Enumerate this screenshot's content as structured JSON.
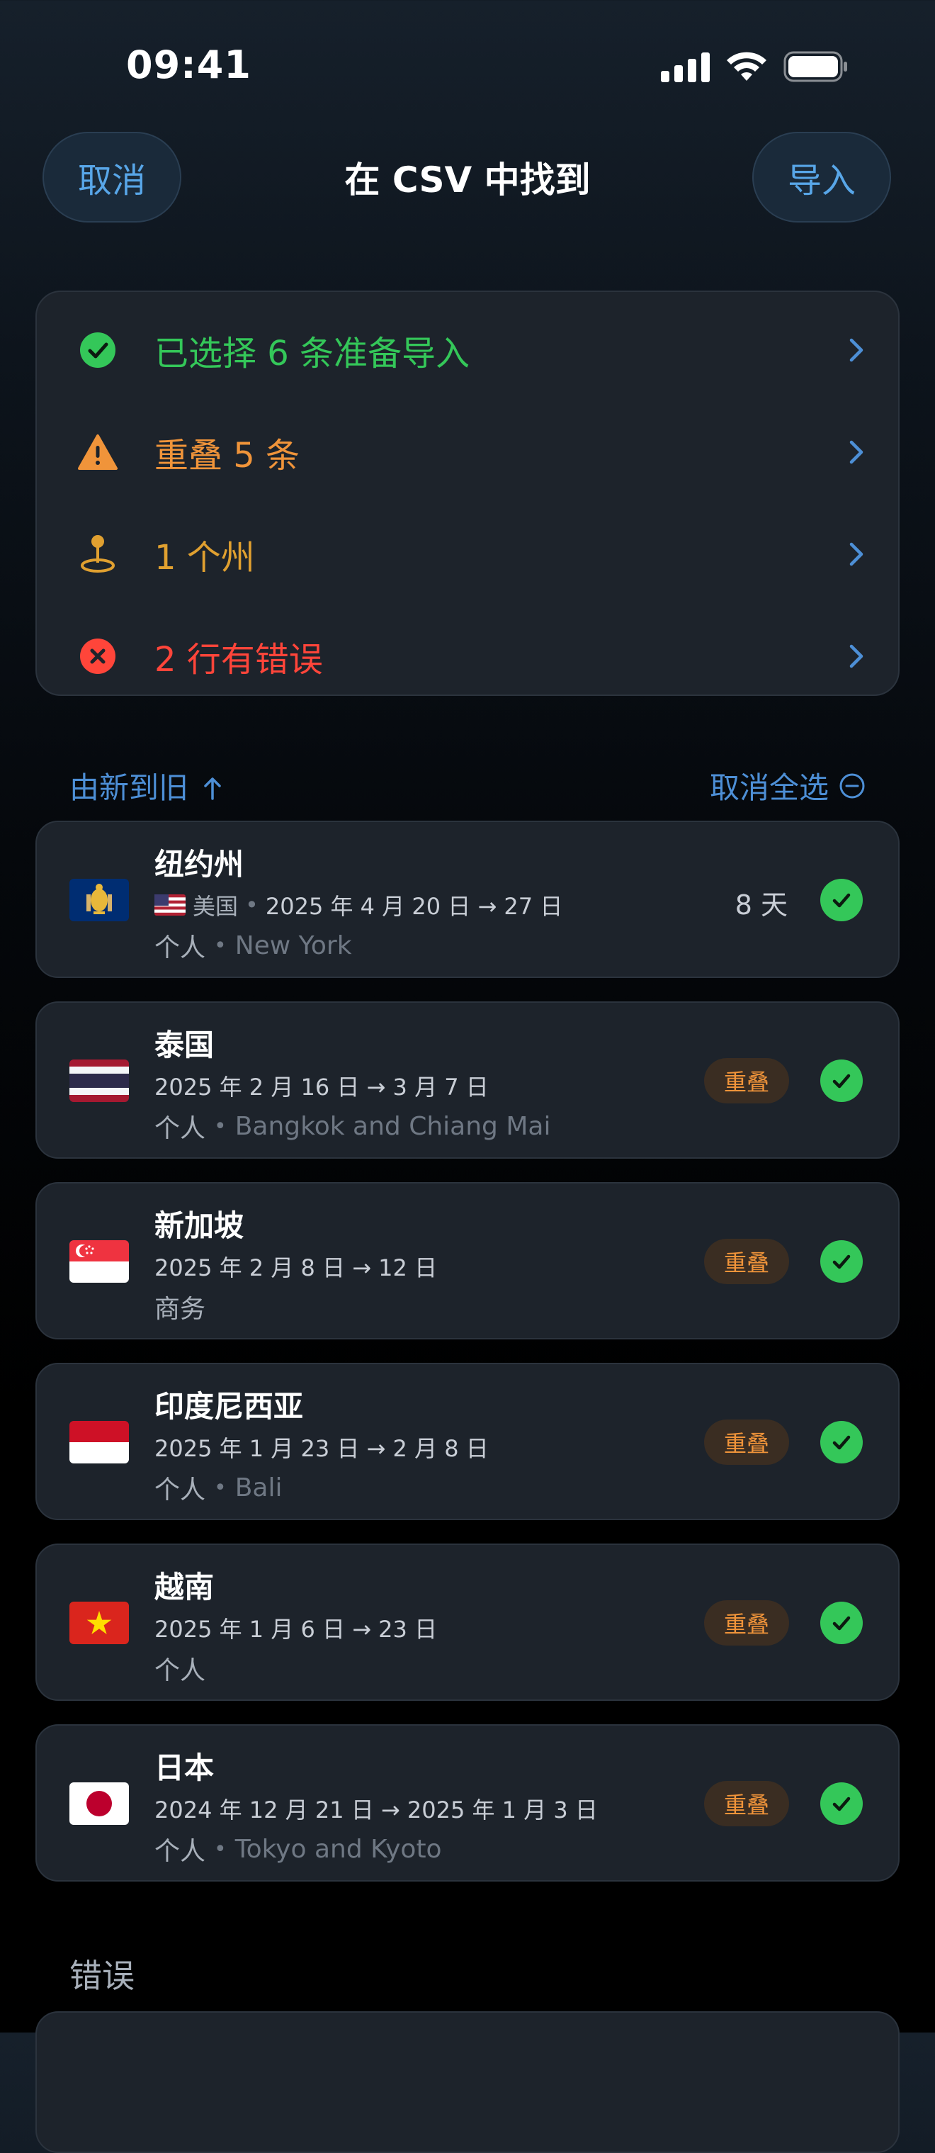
{
  "status": {
    "time": "09:41"
  },
  "nav": {
    "cancel": "取消",
    "title": "在 CSV 中找到",
    "import": "导入"
  },
  "summary": [
    {
      "label": "已选择 6 条准备导入",
      "color": "#34c759",
      "icon": "check-circle-icon"
    },
    {
      "label": "重叠 5 条",
      "color": "#f0943a",
      "icon": "warning-triangle-icon"
    },
    {
      "label": "1 个州",
      "color": "#e0a030",
      "icon": "map-pin-icon"
    },
    {
      "label": "2 行有错误",
      "color": "#ff453a",
      "icon": "x-circle-icon"
    }
  ],
  "sort": {
    "order": "由新到旧",
    "deselect_all": "取消全选"
  },
  "trips": [
    {
      "name": "纽约州",
      "country": "美国",
      "dates": "2025 年 4 月 20 日 → 27 日",
      "category": "个人",
      "place": "New York",
      "days": "8 天",
      "flag": "new-york-state-flag"
    },
    {
      "name": "泰国",
      "dates": "2025 年 2 月 16 日 → 3 月 7 日",
      "category": "个人",
      "place": "Bangkok and Chiang Mai",
      "badge": "重叠",
      "flag": "thailand-flag"
    },
    {
      "name": "新加坡",
      "dates": "2025 年 2 月 8 日 → 12 日",
      "category": "商务",
      "place": "",
      "badge": "重叠",
      "flag": "singapore-flag"
    },
    {
      "name": "印度尼西亚",
      "dates": "2025 年 1 月 23 日 → 2 月 8 日",
      "category": "个人",
      "place": "Bali",
      "badge": "重叠",
      "flag": "indonesia-flag"
    },
    {
      "name": "越南",
      "dates": "2025 年 1 月 6 日 → 23 日",
      "category": "个人",
      "place": "",
      "badge": "重叠",
      "flag": "vietnam-flag"
    },
    {
      "name": "日本",
      "dates": "2024 年 12 月 21 日 → 2025 年 1 月 3 日",
      "category": "个人",
      "place": "Tokyo and Kyoto",
      "badge": "重叠",
      "flag": "japan-flag"
    }
  ],
  "errors": {
    "section_title": "错误"
  }
}
